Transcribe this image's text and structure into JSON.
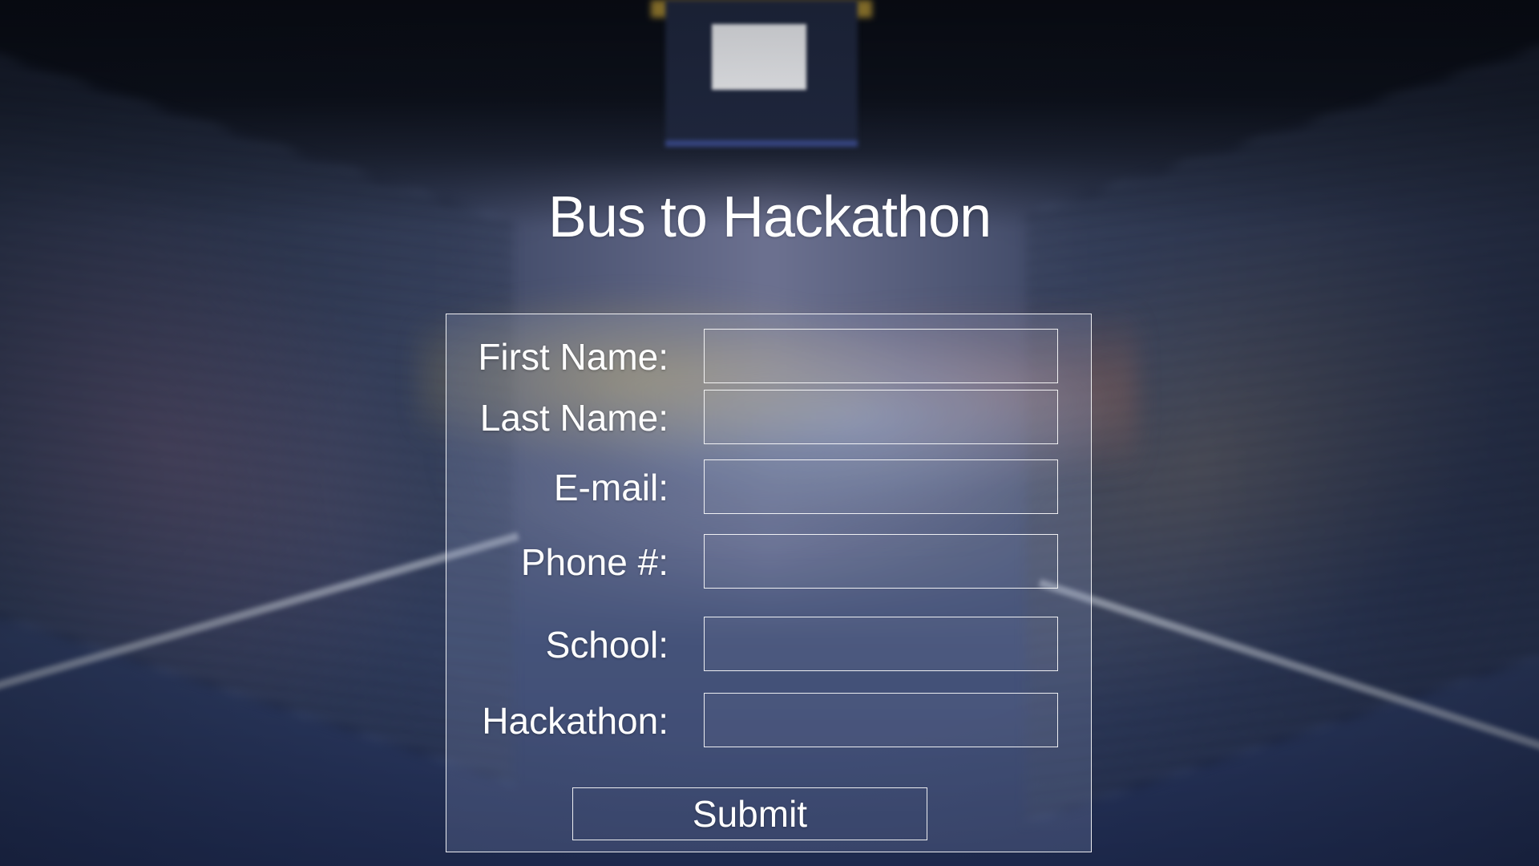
{
  "page": {
    "title": "Bus to Hackathon"
  },
  "form": {
    "fields": [
      {
        "label": "First Name:",
        "value": "",
        "placeholder": ""
      },
      {
        "label": "Last Name:",
        "value": "",
        "placeholder": ""
      },
      {
        "label": "E-mail:",
        "value": "",
        "placeholder": ""
      },
      {
        "label": "Phone #:",
        "value": "",
        "placeholder": ""
      },
      {
        "label": "School:",
        "value": "",
        "placeholder": ""
      },
      {
        "label": "Hackathon:",
        "value": "",
        "placeholder": ""
      }
    ],
    "submit_label": "Submit"
  },
  "theme": {
    "text_color": "#ffffff",
    "border_color": "#ffffff"
  }
}
